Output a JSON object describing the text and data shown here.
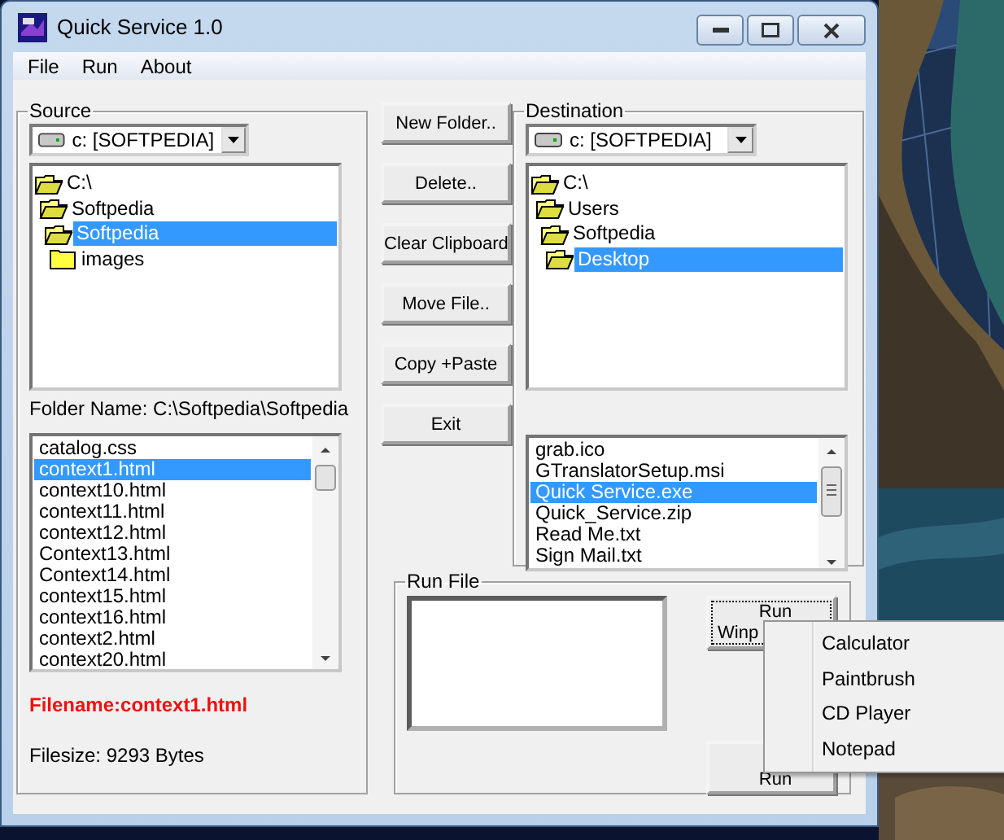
{
  "window": {
    "title": "Quick Service 1.0"
  },
  "menu": [
    "File",
    "Run",
    "About"
  ],
  "source": {
    "label": "Source",
    "drive": "c: [SOFTPEDIA]",
    "tree": [
      {
        "label": "C:\\",
        "selected": false,
        "children": [
          {
            "label": "Softpedia",
            "selected": false,
            "children": [
              {
                "label": "Softpedia",
                "selected": true,
                "children": [
                  {
                    "label": "images",
                    "selected": false,
                    "open": false
                  }
                ]
              }
            ]
          }
        ]
      }
    ],
    "folder_name": "Folder Name: C:\\Softpedia\\Softpedia",
    "files": [
      {
        "name": "catalog.css",
        "selected": false
      },
      {
        "name": "context1.html",
        "selected": true
      },
      {
        "name": "context10.html",
        "selected": false
      },
      {
        "name": "context11.html",
        "selected": false
      },
      {
        "name": "context12.html",
        "selected": false
      },
      {
        "name": "Context13.html",
        "selected": false
      },
      {
        "name": "Context14.html",
        "selected": false
      },
      {
        "name": "context15.html",
        "selected": false
      },
      {
        "name": "context16.html",
        "selected": false
      },
      {
        "name": "context2.html",
        "selected": false
      },
      {
        "name": "context20.html",
        "selected": false
      }
    ],
    "filename": "Filename:context1.html",
    "filesize": "Filesize: 9293 Bytes"
  },
  "actions": [
    "New Folder..",
    "Delete..",
    "Clear Clipboard",
    "Move File..",
    "Copy +Paste",
    "Exit"
  ],
  "destination": {
    "label": "Destination",
    "drive": "c: [SOFTPEDIA]",
    "tree": [
      {
        "label": "C:\\",
        "selected": false,
        "children": [
          {
            "label": "Users",
            "selected": false,
            "children": [
              {
                "label": "Softpedia",
                "selected": false,
                "children": [
                  {
                    "label": "Desktop",
                    "selected": true,
                    "open": true
                  }
                ]
              }
            ]
          }
        ]
      }
    ],
    "files": [
      {
        "name": "grab.ico",
        "selected": false
      },
      {
        "name": "GTranslatorSetup.msi",
        "selected": false
      },
      {
        "name": "Quick Service.exe",
        "selected": true
      },
      {
        "name": "Quick_Service.zip",
        "selected": false
      },
      {
        "name": "Read Me.txt",
        "selected": false
      },
      {
        "name": "Sign Mail.txt",
        "selected": false
      }
    ]
  },
  "run_file": {
    "label": "Run File",
    "run_program_button": [
      "Run",
      "Winp"
    ],
    "run_button": "Run"
  },
  "context_menu": [
    "Calculator",
    "Paintbrush",
    "CD Player",
    "Notepad"
  ],
  "wallpaper": {
    "kind": "picture"
  }
}
